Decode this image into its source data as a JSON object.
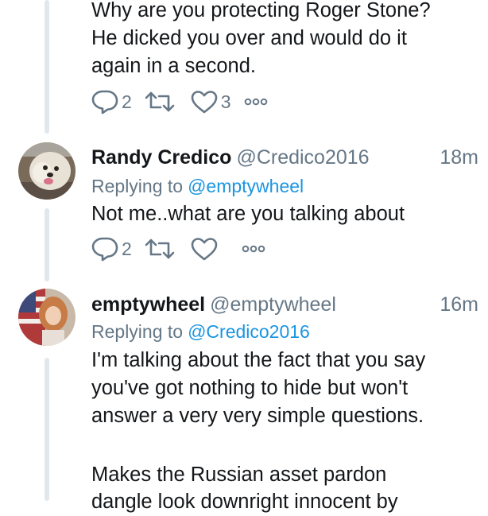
{
  "tweet1": {
    "text": "Why are you protecting Roger Stone?\nHe dicked you over and would do it\nagain in a second.",
    "reply_count": "2",
    "retweet_count": "",
    "like_count": "3"
  },
  "tweet2": {
    "name": "Randy Credico",
    "handle": "@Credico2016",
    "time": "18m",
    "replying_label": "Replying to",
    "replying_to": "@emptywheel",
    "text": "Not me..what are you talking about",
    "reply_count": "2",
    "retweet_count": "",
    "like_count": ""
  },
  "tweet3": {
    "name": "emptywheel",
    "handle": "@emptywheel",
    "time": "16m",
    "replying_label": "Replying to",
    "replying_to": "@Credico2016",
    "text": "I'm talking about the fact that you say\nyou've got nothing to hide but won't\nanswer a very very simple questions.",
    "text2": "Makes the Russian asset pardon",
    "text3_partial": "dangle look downright innocent by"
  },
  "colors": {
    "name": "#14171a",
    "secondary": "#657786",
    "link": "#1b95e0",
    "thread_line": "#e1e8ed"
  },
  "icons": [
    "reply-icon",
    "retweet-icon",
    "like-icon",
    "more-icon"
  ]
}
